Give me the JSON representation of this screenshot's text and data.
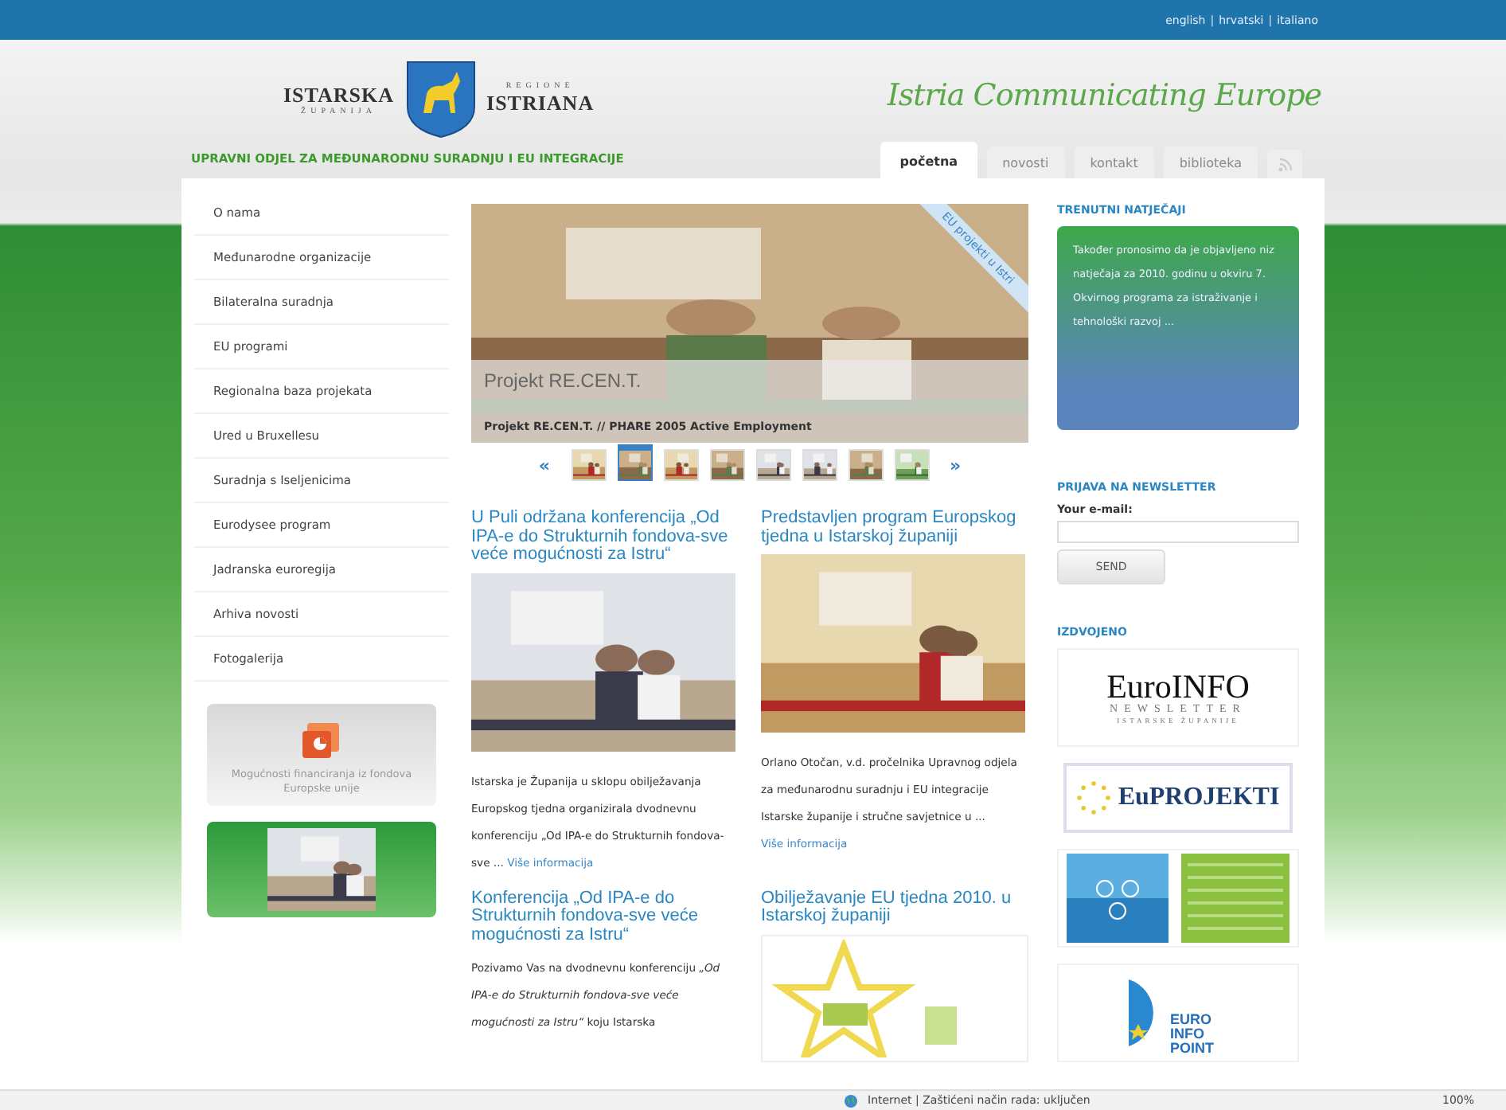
{
  "top_bar": {
    "languages": [
      "english",
      "hrvatski",
      "italiano"
    ],
    "separator": "|"
  },
  "header": {
    "logo_left": "ISTARSKA",
    "logo_left_sub": "ŽUPANIJA",
    "logo_right": "ISTRIANA",
    "logo_right_sub": "REGIONE",
    "department": "UPRAVNI ODJEL ZA MEĐUNARODNU SURADNJU I EU INTEGRACIJE",
    "slogan": "Istria Communicating Europe"
  },
  "tabs": [
    {
      "label": "početna",
      "selected": true
    },
    {
      "label": "novosti",
      "selected": false
    },
    {
      "label": "kontakt",
      "selected": false
    },
    {
      "label": "biblioteka",
      "selected": false
    }
  ],
  "nav": {
    "items": [
      "O nama",
      "Međunarodne organizacije",
      "Bilateralna suradnja",
      "EU programi",
      "Regionalna baza projekata",
      "Ured u Bruxellesu",
      "Suradnja s Iseljenicima",
      "Eurodysee program",
      "Jadranska euroregija",
      "Arhiva novosti",
      "Fotogalerija"
    ]
  },
  "promo": {
    "text": "Mogućnosti financiranja iz fondova Europske unije"
  },
  "slideshow": {
    "ribbon": "EU projekti u Istri",
    "title": "Projekt RE.CEN.T.",
    "caption": "Projekt RE.CEN.T. // PHARE 2005 Active Employment",
    "prev": "«",
    "next": "»",
    "thumbnails": [
      {
        "selected": false
      },
      {
        "selected": true
      },
      {
        "selected": false
      },
      {
        "selected": false
      },
      {
        "selected": false
      },
      {
        "selected": false
      },
      {
        "selected": false
      },
      {
        "selected": false
      }
    ]
  },
  "articles": [
    {
      "title": "U Puli održana konferencija „Od IPA-e do Strukturnih fondova-sve veće mogućnosti za Istru“",
      "body": "Istarska je Županija u sklopu obilježavanja Europskog tjedna organizirala dvodnevnu konferenciju „Od IPA-e do Strukturnih fondova-sve ...",
      "more": "Više informacija"
    },
    {
      "title": "Predstavljen program Europskog tjedna u Istarskoj županiji",
      "body": "Orlano Otočan, v.d. pročelnika Upravnog odjela za međunarodnu suradnju i EU integracije Istarske županije i stručne savjetnice u ...",
      "more": "Više informacija"
    },
    {
      "kind": "text",
      "title": "Konferencija „Od IPA-e do Strukturnih fondova-sve veće mogućnosti za Istru“",
      "body": "Pozivamo Vas na dvodnevnu konferenciju *„Od IPA-e do Strukturnih fondova-sve veće mogućnosti za Istru“* koju Istarska"
    },
    {
      "kind": "logo",
      "title": "Obilježavanje EU tjedna 2010. u Istarskoj županiji"
    }
  ],
  "competitions": {
    "heading": "TRENUTNI NATJEČAJI",
    "text": "Također pronosimo da je objavljeno niz natječaja za 2010. godinu u okviru 7. Okvirnog programa za istraživanje i tehnološki razvoj ..."
  },
  "newsletter": {
    "heading": "PRIJAVA NA NEWSLETTER",
    "label": "Your e-mail:",
    "button": "SEND"
  },
  "featured": {
    "heading": "IZDVOJENO",
    "banners": [
      {
        "kind": "euroinfo",
        "title": "EuroINFO",
        "subtitle": "NEWSLETTER",
        "tagline": "ISTARSKE ŽUPANIJE"
      },
      {
        "kind": "euprojekti",
        "title": "EuPROJEKTI"
      },
      {
        "kind": "graphic"
      },
      {
        "kind": "eip",
        "title": "EURO INFO POINT"
      }
    ]
  },
  "status_bar": {
    "zone": "Internet | Zaštićeni način rada: uključen",
    "zoom": "100%"
  }
}
